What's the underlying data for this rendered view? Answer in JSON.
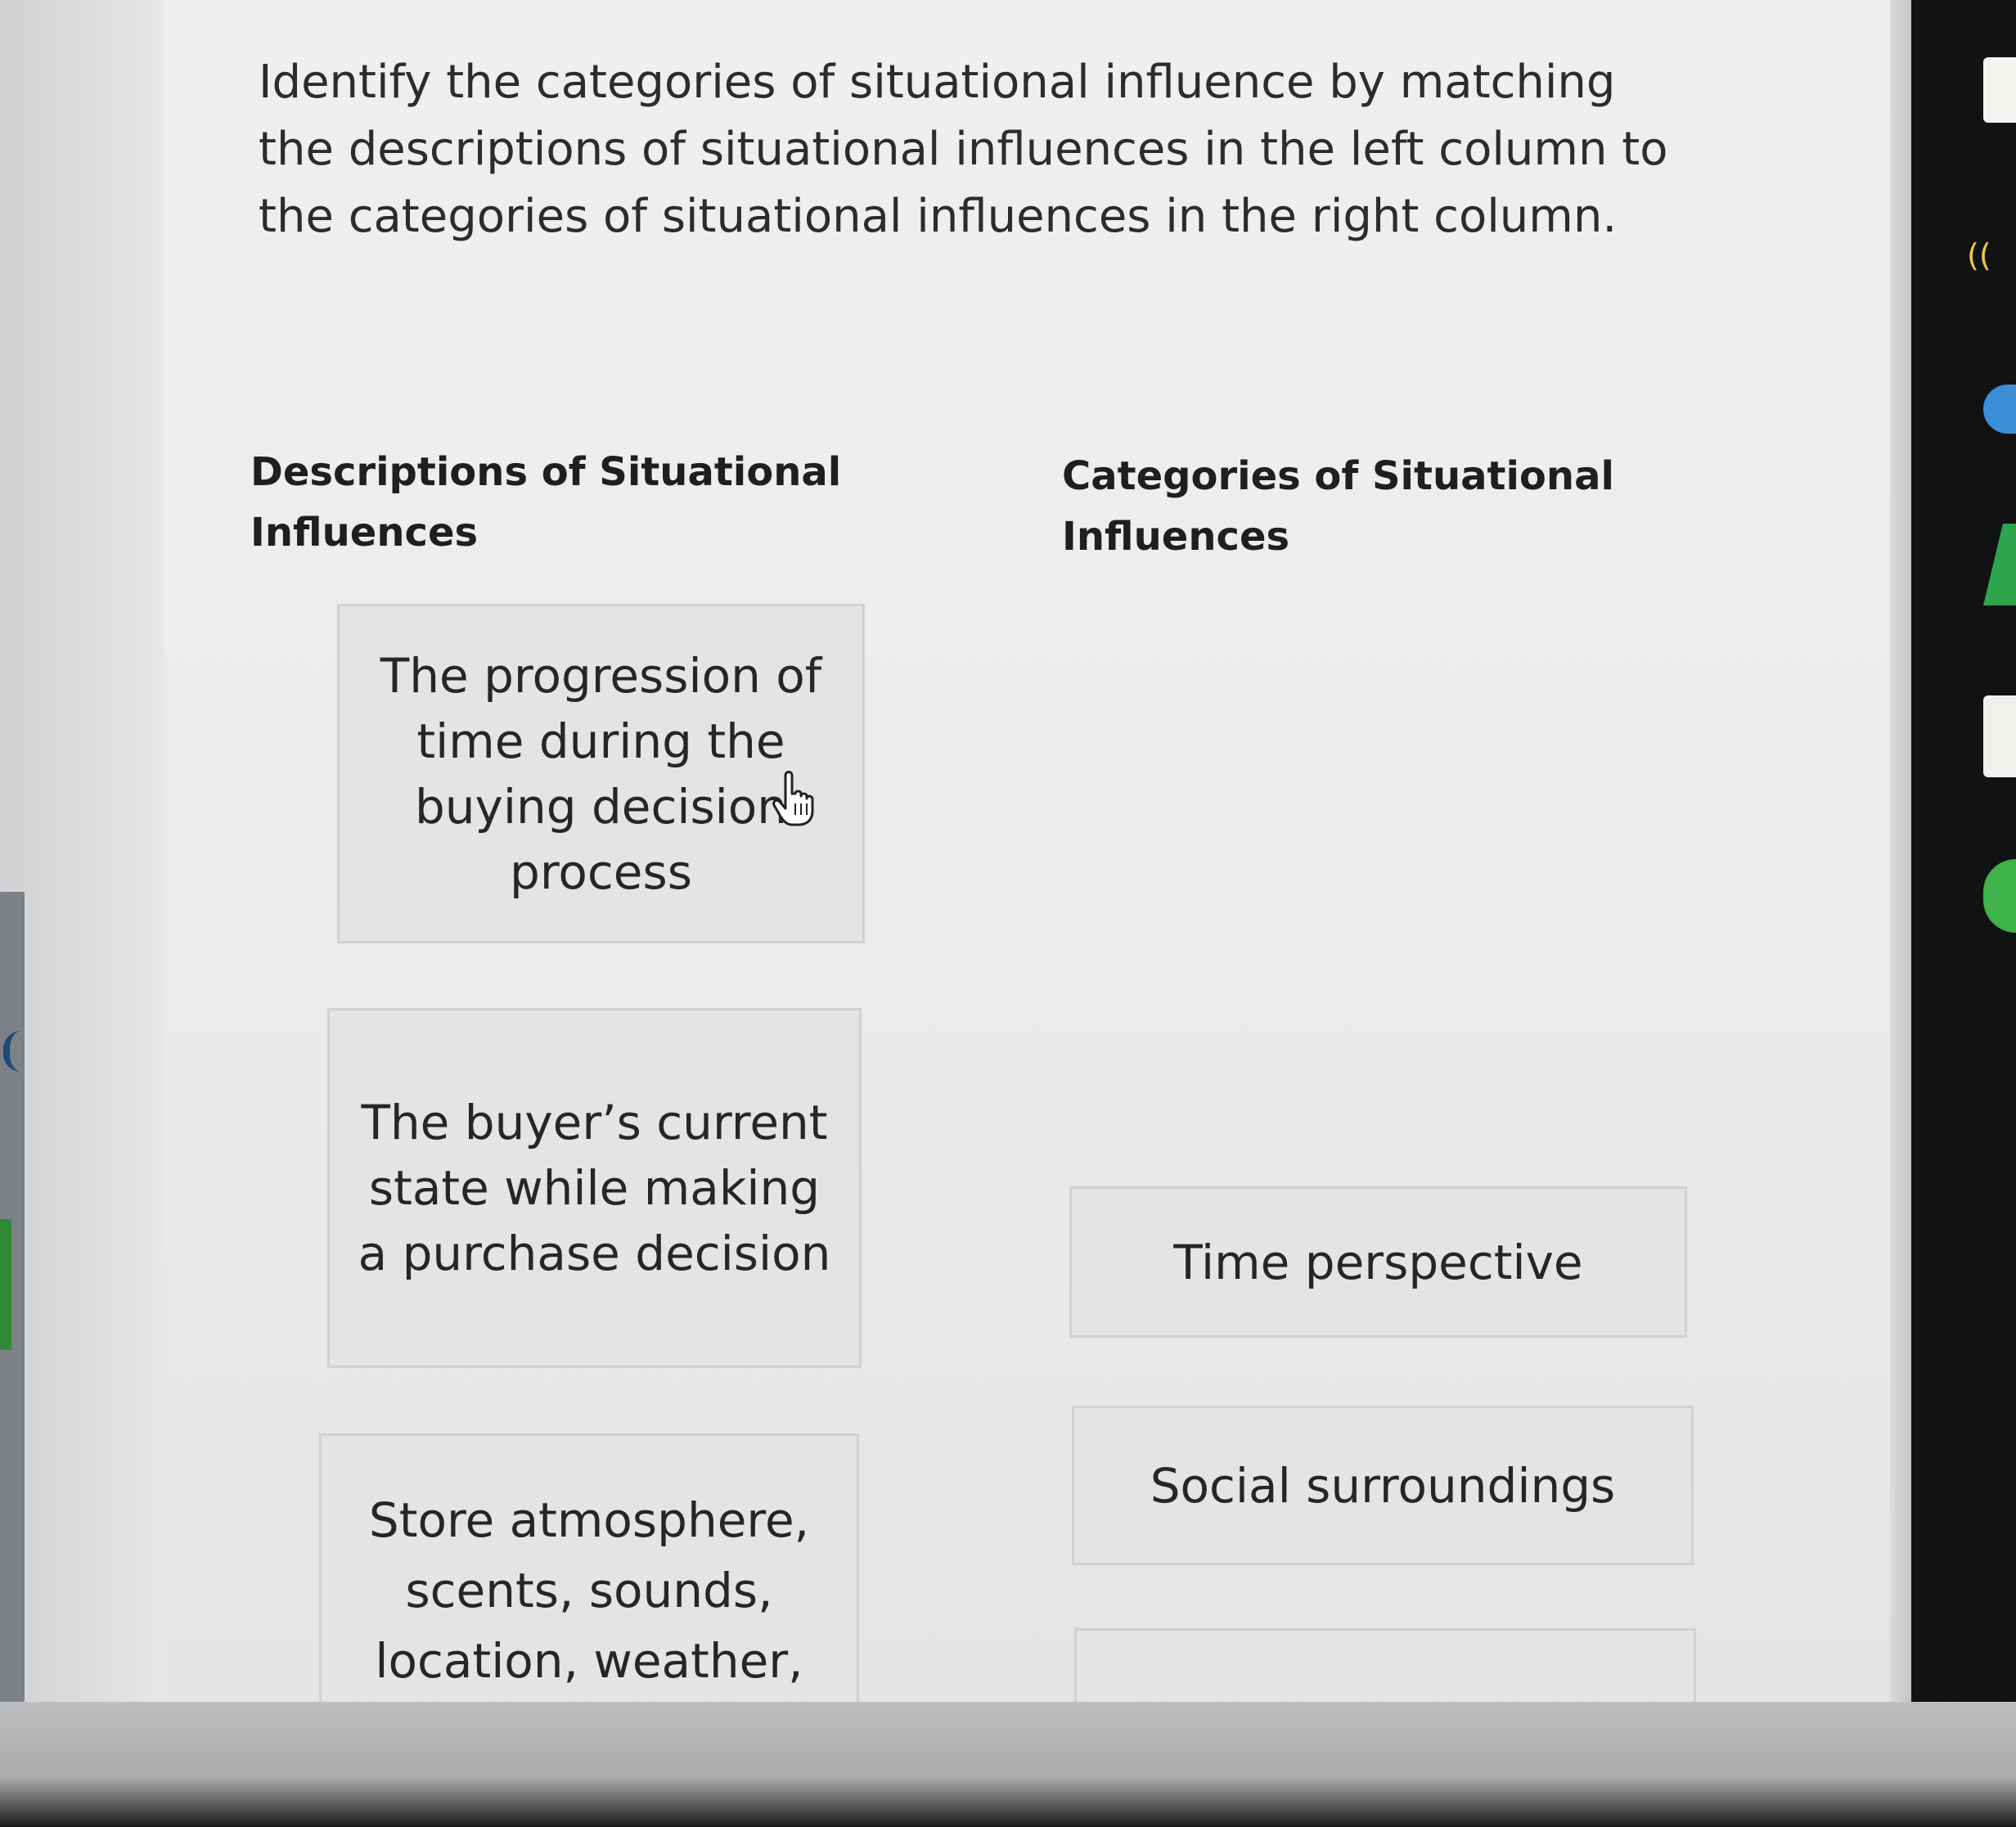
{
  "question": {
    "instructions": "Identify the categories of situational influence by matching the descriptions of situational influences in the left column to the categories of situational influences in the right column."
  },
  "left_column": {
    "header": "Descriptions of Situational Influences",
    "items": [
      {
        "label": "The progression of time during the buying decision process"
      },
      {
        "label": "The buyer’s current state while making a purchase decision"
      },
      {
        "label": "Store atmosphere, scents, sounds, location, weather,"
      }
    ]
  },
  "right_column": {
    "header": "Categories of Situational Influences",
    "items": [
      {
        "label": "Time perspective"
      },
      {
        "label": "Social surroundings"
      },
      {
        "label": ""
      }
    ]
  },
  "cursor": {
    "icon": "hand-pointer-icon"
  }
}
